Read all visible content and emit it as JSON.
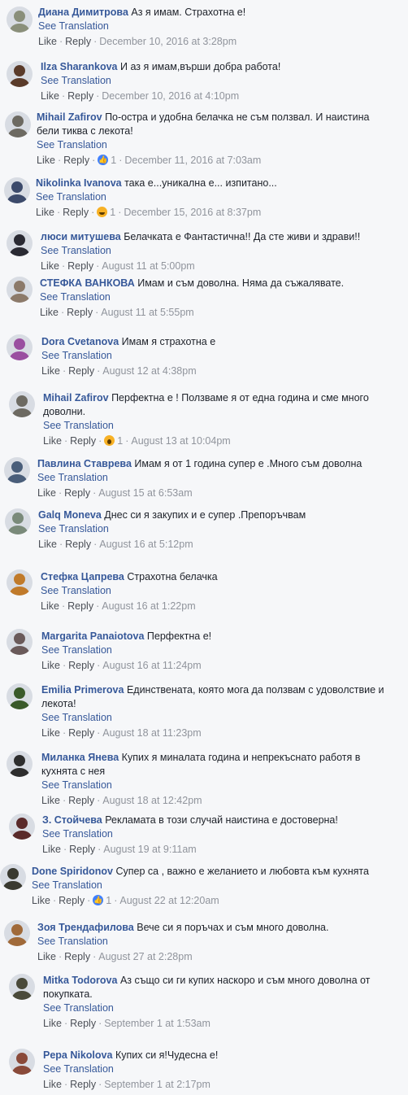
{
  "labels": {
    "translate": "See Translation",
    "like": "Like",
    "reply": "Reply",
    "sep": "·"
  },
  "comments": [
    {
      "name": "Диана Димитрова",
      "text": "Аз я имам. Страхотна е!",
      "date": "December 10, 2016 at 3:28pm",
      "avatar_color": "#8a8f7a",
      "reaction": null
    },
    {
      "name": "Ilza Sharankova",
      "text": "И аз я имам,върши добра работа!",
      "date": "December 10, 2016 at 4:10pm",
      "avatar_color": "#5a3b2a",
      "reaction": null
    },
    {
      "name": "Mihail Zafirov",
      "text": "По-остра и удобна белачка не съм ползвал. И наистина бели тиква с лекота!",
      "date": "December 11, 2016 at 7:03am",
      "avatar_color": "#6d6a62",
      "reaction": {
        "type": "like",
        "count": "1"
      }
    },
    {
      "name": "Nikolinka Ivanova",
      "text": "така е...уникална е... изпитано...",
      "date": "December 15, 2016 at 8:37pm",
      "avatar_color": "#3c4a6b",
      "reaction": {
        "type": "haha",
        "count": "1"
      }
    },
    {
      "name": "люси митушева",
      "text": "Белачката е Фантастична!! Да сте живи и здрави!!",
      "date": "August 11 at 5:00pm",
      "avatar_color": "#2a2a33",
      "reaction": null
    },
    {
      "name": "СТЕФКА ВАНКОВА",
      "text": "Имам и съм доволна. Няма да съжалявате.",
      "date": "August 11 at 5:55pm",
      "avatar_color": "#8c7a6a",
      "reaction": null
    },
    {
      "name": "Dora Cvetanova",
      "text": "Имам я страхотна е",
      "date": "August 12 at 4:38pm",
      "avatar_color": "#9a4fa0",
      "reaction": null
    },
    {
      "name": "Mihail Zafirov",
      "text": "Перфектна е ! Ползваме я от една година и сме много доволни.",
      "date": "August 13 at 10:04pm",
      "avatar_color": "#6d6a62",
      "reaction": {
        "type": "wow",
        "count": "1"
      }
    },
    {
      "name": "Павлина Ставрева",
      "text": "Имам я от 1 година супер е .Много съм доволна",
      "date": "August 15 at 6:53am",
      "avatar_color": "#4a5e7a",
      "reaction": null
    },
    {
      "name": "Galq Moneva",
      "text": "Днес си я закупих и е супер .Препоръчвам",
      "date": "August 16 at 5:12pm",
      "avatar_color": "#7a8a7a",
      "reaction": null
    },
    {
      "name": "Стефка Цапрева",
      "text": "Страхотна белачка",
      "date": "August 16 at 1:22pm",
      "avatar_color": "#c07a2a",
      "reaction": null
    },
    {
      "name": "Margarita Panaiotova",
      "text": "Перфектна е!",
      "date": "August 16 at 11:24pm",
      "avatar_color": "#6a5a5a",
      "reaction": null
    },
    {
      "name": "Emilia Primerova",
      "text": "Единствената, която мога да ползвам с удоволствие и лекота!",
      "date": "August 18 at 11:23pm",
      "avatar_color": "#3a5a2a",
      "reaction": null
    },
    {
      "name": "Миланка Янева",
      "text": "Купих я миналата година и непрекъснато работя в кухнята с нея",
      "date": "August 18 at 12:42pm",
      "avatar_color": "#2e2e2e",
      "reaction": null
    },
    {
      "name": "З. Стойчева",
      "text": "Рекламата в този случай наистина е достоверна!",
      "date": "August 19 at 9:11am",
      "avatar_color": "#5a2a2a",
      "reaction": null
    },
    {
      "name": "Done Spiridonov",
      "text": "Супер са , важно е желанието и любовта към кухнята",
      "date": "August 22 at 12:20am",
      "avatar_color": "#3a3a30",
      "reaction": {
        "type": "like",
        "count": "1"
      }
    },
    {
      "name": "Зоя Трендафилова",
      "text": "Вече си я поръчах и съм много доволна.",
      "date": "August 27 at 2:28pm",
      "avatar_color": "#a06a3a",
      "reaction": null
    },
    {
      "name": "Mitka Todorova",
      "text": "Аз също си ги купих наскоро и съм много доволна от покупката.",
      "date": "September 1 at 1:53am",
      "avatar_color": "#4a4a3a",
      "reaction": null
    },
    {
      "name": "Pepa Nikolova",
      "text": "Купих си я!Чудесна е!",
      "date": "September 1 at 2:17pm",
      "avatar_color": "#8a4a3a",
      "reaction": null
    }
  ]
}
